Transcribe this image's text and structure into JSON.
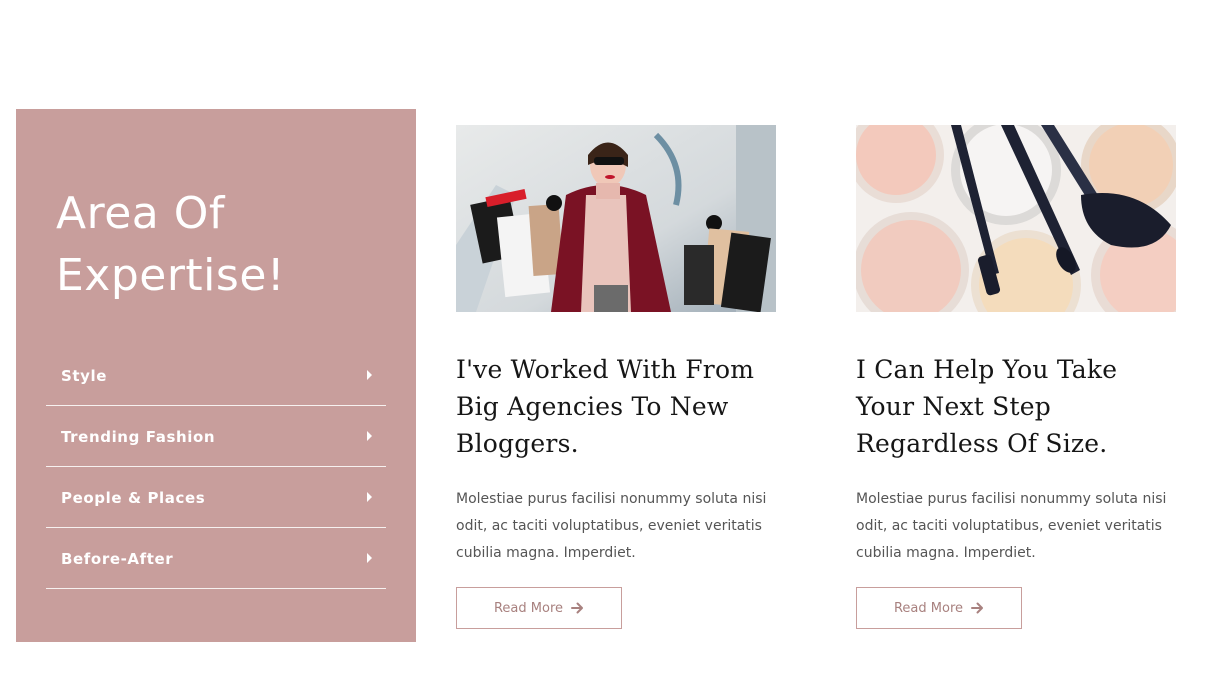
{
  "expertise": {
    "title_line1": "Area Of",
    "title_line2": "Expertise!",
    "items": [
      {
        "label": "Style",
        "icon": "caret-right-icon"
      },
      {
        "label": "Trending Fashion",
        "icon": "caret-right-icon"
      },
      {
        "label": "People & Places",
        "icon": "caret-right-icon"
      },
      {
        "label": "Before-After",
        "icon": "caret-right-icon"
      }
    ],
    "panel_color": "#c89e9c"
  },
  "articles": [
    {
      "image": "woman-shopping-bags-photo",
      "title": "I've Worked With From Big Agencies To New Bloggers.",
      "excerpt": "Molestiae purus facilisi nonummy soluta nisi odit, ac taciti voluptatibus, eveniet veritatis cubilia magna. Imperdiet.",
      "button_label": "Read More",
      "button_icon": "arrow-right-icon"
    },
    {
      "image": "makeup-powder-brushes-photo",
      "title": "I Can Help You Take Your Next Step Regardless Of Size.",
      "excerpt": "Molestiae purus facilisi nonummy soluta nisi odit, ac taciti voluptatibus, eveniet veritatis cubilia magna. Imperdiet.",
      "button_label": "Read More",
      "button_icon": "arrow-right-icon"
    }
  ],
  "colors": {
    "accent": "#c89e9c",
    "button_text": "#a8817f",
    "heading": "#161616",
    "body_text": "#555555"
  }
}
